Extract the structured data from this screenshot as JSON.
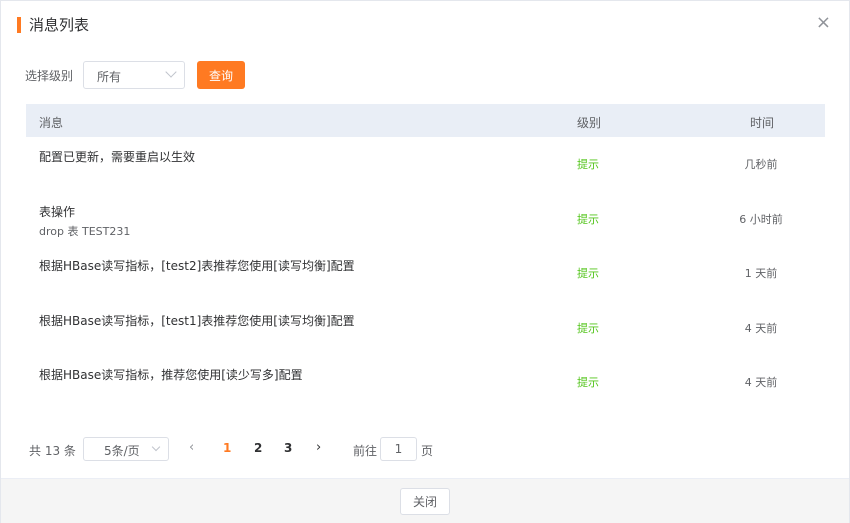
{
  "dialog": {
    "title": "消息列表",
    "close_glyph": "×"
  },
  "filter": {
    "label": "选择级别",
    "selected": "所有",
    "query_label": "查询"
  },
  "table": {
    "headers": {
      "message": "消息",
      "level": "级别",
      "time": "时间"
    },
    "rows": [
      {
        "title": "配置已更新，需要重启以生效",
        "sub": "",
        "level": "提示",
        "time": "几秒前"
      },
      {
        "title": "表操作",
        "sub": "drop 表 TEST231",
        "level": "提示",
        "time": "6 小时前"
      },
      {
        "title": "根据HBase读写指标，[test2]表推荐您使用[读写均衡]配置",
        "sub": "",
        "level": "提示",
        "time": "1 天前"
      },
      {
        "title": "根据HBase读写指标，[test1]表推荐您使用[读写均衡]配置",
        "sub": "",
        "level": "提示",
        "time": "4 天前"
      },
      {
        "title": "根据HBase读写指标，推荐您使用[读少写多]配置",
        "sub": "",
        "level": "提示",
        "time": "4 天前"
      }
    ]
  },
  "pagination": {
    "total": "共 13 条",
    "page_size": "5条/页",
    "prev": "‹",
    "next": "›",
    "pages": [
      "1",
      "2",
      "3"
    ],
    "current_page": "1",
    "goto_label": "前往",
    "goto_value": "1",
    "goto_suffix": "页"
  },
  "footer": {
    "close_label": "关闭"
  },
  "colors": {
    "accent": "#ff7a22",
    "level_info": "#52c41a",
    "header_bg": "#e9eef6"
  }
}
